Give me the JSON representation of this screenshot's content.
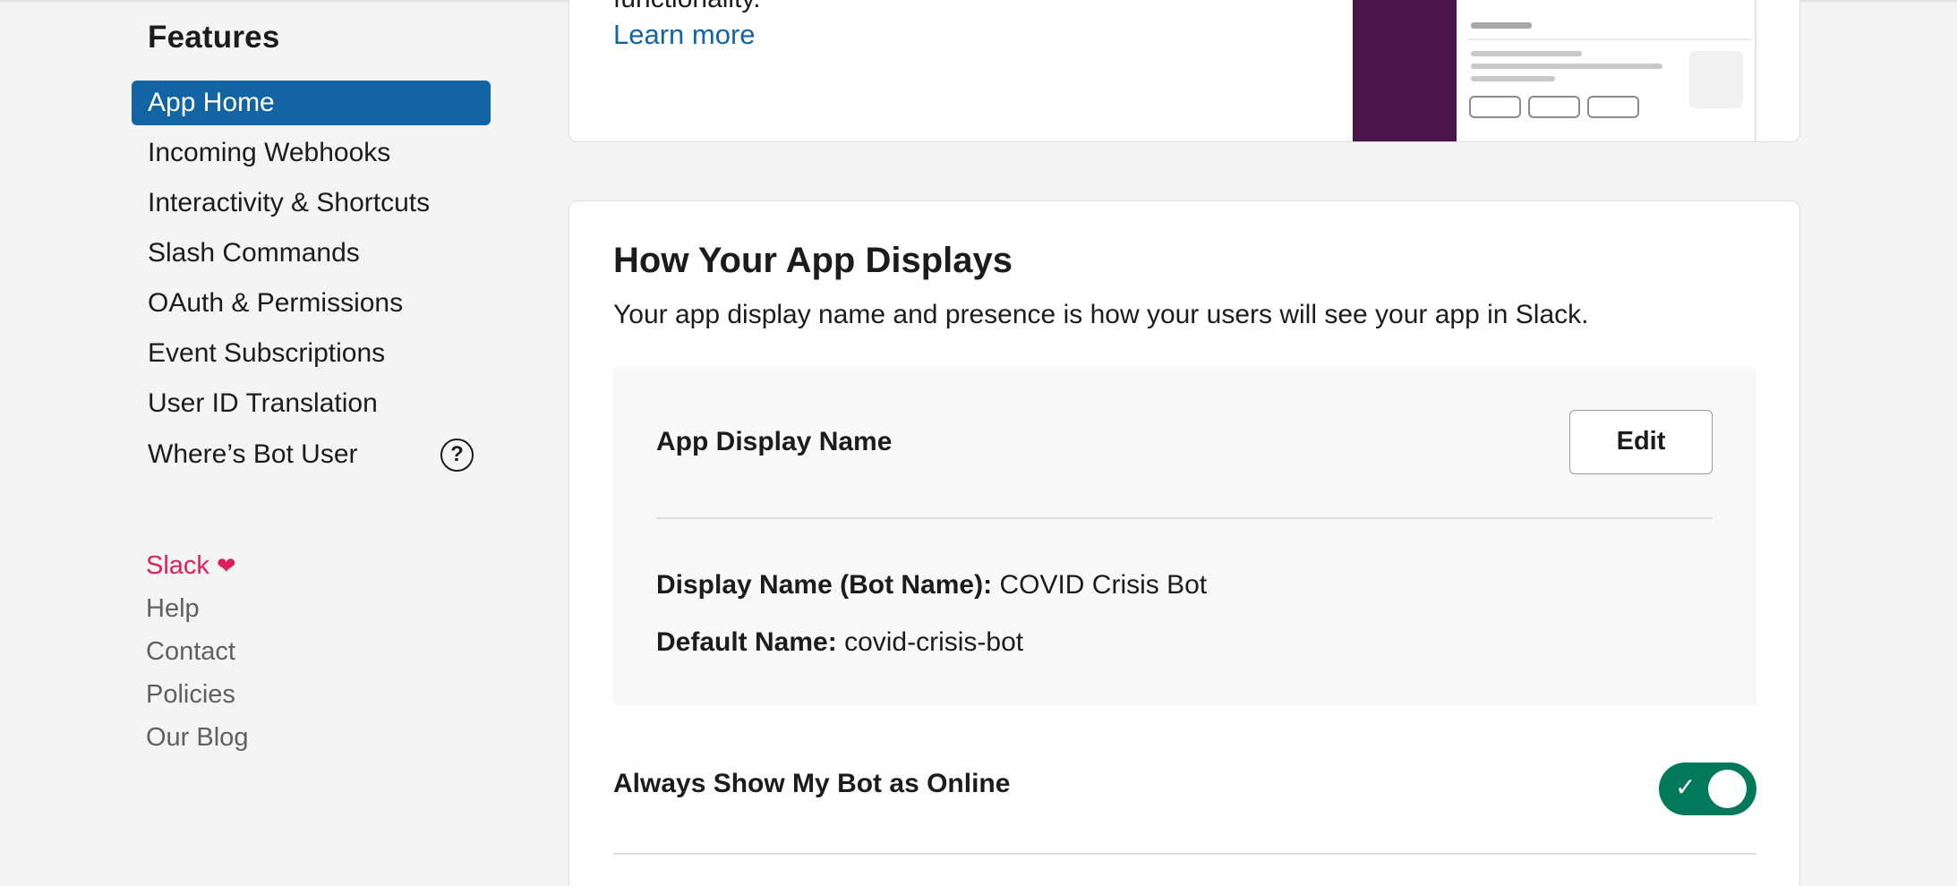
{
  "sidebar": {
    "section_title": "Features",
    "items": [
      {
        "label": "App Home",
        "active": true
      },
      {
        "label": "Incoming Webhooks"
      },
      {
        "label": "Interactivity & Shortcuts"
      },
      {
        "label": "Slash Commands"
      },
      {
        "label": "OAuth & Permissions"
      },
      {
        "label": "Event Subscriptions"
      },
      {
        "label": "User ID Translation"
      },
      {
        "label": "Where’s Bot User"
      }
    ],
    "help_glyph": "?",
    "footer": {
      "slack": "Slack",
      "heart": "❤",
      "help": "Help",
      "contact": "Contact",
      "policies": "Policies",
      "blog": "Our Blog"
    }
  },
  "top_card": {
    "cut_text": "functionality.",
    "learn_more": "Learn more"
  },
  "display_card": {
    "title": "How Your App Displays",
    "description": "Your app display name and presence is how your users will see your app in Slack.",
    "app_display_name_label": "App Display Name",
    "edit_button": "Edit",
    "display_name_key": "Display Name (Bot Name):",
    "display_name_value": "COVID Crisis Bot",
    "default_name_key": "Default Name:",
    "default_name_value": "covid-crisis-bot",
    "always_online_label": "Always Show My Bot as Online",
    "always_online_on": true,
    "toggle_check": "✓"
  },
  "colors": {
    "active_nav": "#1264a3",
    "link": "#1264a3",
    "slack_pink": "#e01e5a",
    "toggle_on": "#007a5a",
    "illustration_purple": "#4a154b"
  }
}
